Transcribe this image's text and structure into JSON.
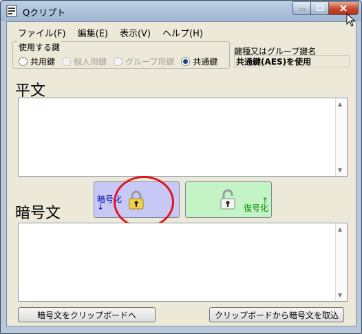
{
  "window": {
    "title": "Qクリプト",
    "accent": "#9fb6d1"
  },
  "menu": [
    {
      "label": "ファイル(F)"
    },
    {
      "label": "編集(E)"
    },
    {
      "label": "表示(V)"
    },
    {
      "label": "ヘルプ(H)"
    }
  ],
  "key_group": {
    "legend": "使用する鍵",
    "options": [
      {
        "label": "共用鍵",
        "state": "unchecked"
      },
      {
        "label": "個人用鍵",
        "state": "disabled"
      },
      {
        "label": "グループ用鍵",
        "state": "disabled"
      },
      {
        "label": "共通鍵",
        "state": "checked"
      }
    ]
  },
  "key_info": {
    "label": "鍵種又はグループ鍵名",
    "value": "共通鍵(AES)を使用"
  },
  "plaintext": {
    "title": "平文",
    "value": ""
  },
  "ciphertext": {
    "title": "暗号文",
    "value": ""
  },
  "encrypt_button": {
    "label_line1": "暗号化",
    "arrow": "↓",
    "icon": "lock-closed-icon",
    "color": "#c8c8f7"
  },
  "decrypt_button": {
    "label_line1": "復号化",
    "arrow": "↑",
    "icon": "lock-open-icon",
    "color": "#c4f4c6"
  },
  "buttons": {
    "copy_to_clipboard": "暗号文をクリップボードへ",
    "paste_from_clipboard": "クリップボードから暗号文を取込"
  },
  "annotation_color": "#e0141e"
}
